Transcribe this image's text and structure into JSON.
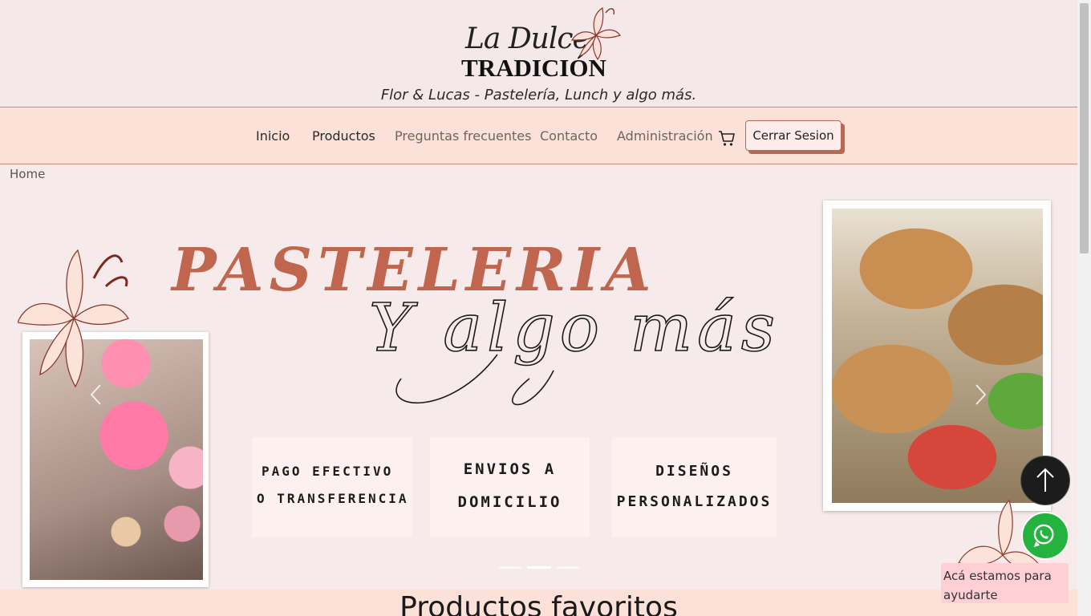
{
  "header": {
    "logo_line1": "La Dulce",
    "logo_line2": "TRADICIÓN",
    "tagline": "Flor & Lucas - Pastelería, Lunch y algo más."
  },
  "nav": {
    "items": [
      {
        "label": "Inicio"
      },
      {
        "label": "Productos"
      },
      {
        "label": "Preguntas frecuentes"
      },
      {
        "label": "Contacto"
      },
      {
        "label": "Administración"
      }
    ],
    "cart_icon": "cart-icon",
    "logout_label": "Cerrar Sesion"
  },
  "breadcrumb": "Home",
  "hero": {
    "title": "PASTELERIA",
    "script_text": "Y algo más",
    "features": [
      {
        "line1": "PAGO EFECTIVO",
        "line2": "O TRANSFERENCIA"
      },
      {
        "line1": "ENVIOS A",
        "line2": "DOMICILIO"
      },
      {
        "line1": "DISEÑOS",
        "line2": "PERSONALIZADOS"
      }
    ],
    "slides_total": 3,
    "active_slide": 2
  },
  "favorites": {
    "title": "Productos favoritos"
  },
  "floating": {
    "to_top_icon": "arrow-up-icon",
    "whatsapp_icon": "whatsapp-icon",
    "help_text": "Acá estamos para ayudarte"
  },
  "colors": {
    "accent": "#c0664f",
    "nav_bg": "#fbe1d8",
    "page_bg": "#f6eaea",
    "whatsapp": "#25b33f"
  }
}
